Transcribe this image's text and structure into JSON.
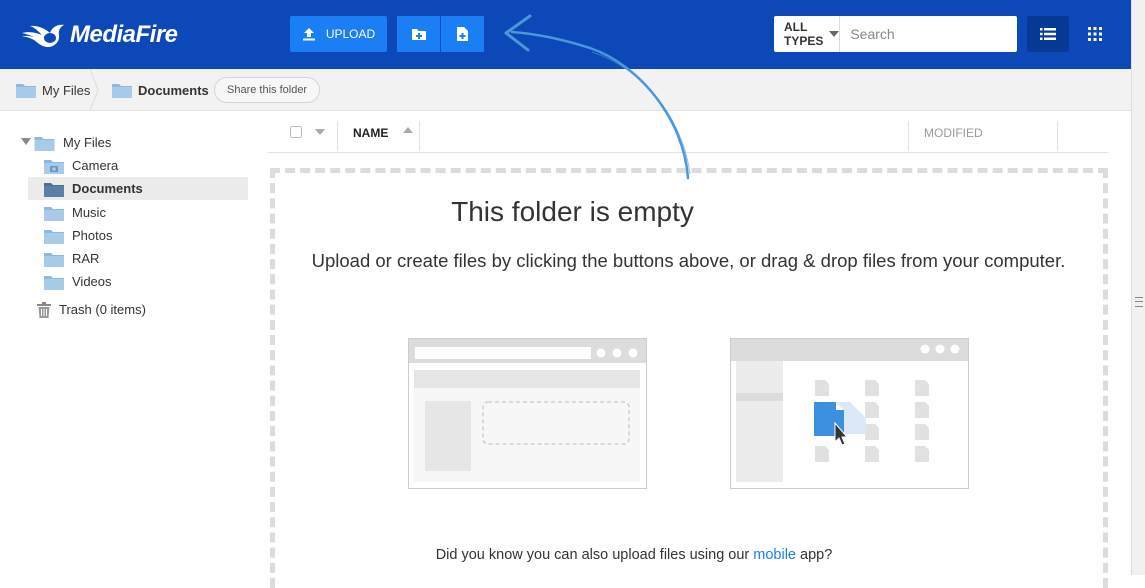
{
  "header": {
    "brand": "MediaFire",
    "upload_label": "UPLOAD",
    "type_filter": "ALL TYPES",
    "search_placeholder": "Search",
    "colors": {
      "bar": "#0c48b7",
      "button": "#1a7ef4",
      "active": "#073a94"
    }
  },
  "breadcrumb": {
    "root": "My Files",
    "current": "Documents",
    "share_label": "Share this folder"
  },
  "sidebar": {
    "root": "My Files",
    "items": [
      {
        "label": "Camera"
      },
      {
        "label": "Documents"
      },
      {
        "label": "Music"
      },
      {
        "label": "Photos"
      },
      {
        "label": "RAR"
      },
      {
        "label": "Videos"
      }
    ],
    "trash": "Trash (0 items)"
  },
  "columns": {
    "name": "NAME",
    "modified": "MODIFIED"
  },
  "empty": {
    "title": "This folder is empty",
    "subtitle": "Upload or create files by clicking the buttons above, or drag & drop files from your computer.",
    "mobile_prefix": "Did you know you can also upload files using our ",
    "mobile_link": "mobile",
    "mobile_suffix": " app?"
  }
}
